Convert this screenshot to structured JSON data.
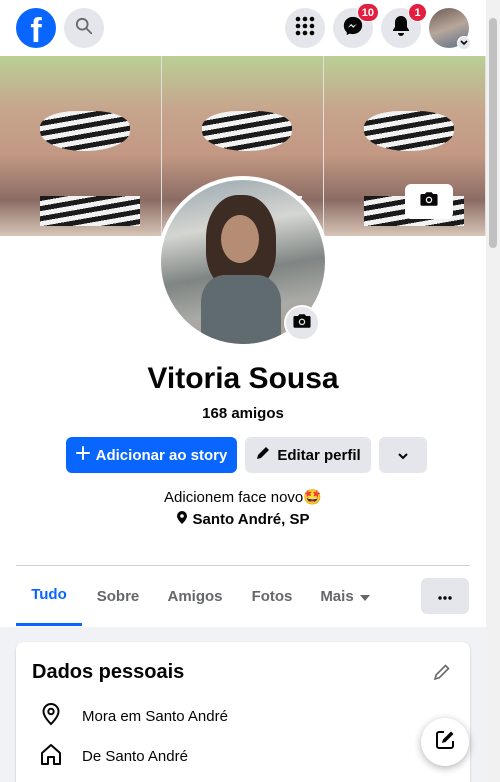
{
  "nav": {
    "logo": "f",
    "messenger_badge": "10",
    "notifications_badge": "1",
    "icons": [
      "search-icon",
      "grid-menu-icon",
      "messenger-icon",
      "bell-icon",
      "chevron-down-icon"
    ]
  },
  "profile": {
    "name": "Vitoria Sousa",
    "friends": "168 amigos",
    "bio": "Adicionem face novo🤩",
    "location": "Santo André, SP"
  },
  "actions": {
    "add_story": "Adicionar ao story",
    "edit_profile": "Editar perfil"
  },
  "tabs": [
    {
      "label": "Tudo",
      "active": true
    },
    {
      "label": "Sobre"
    },
    {
      "label": "Amigos"
    },
    {
      "label": "Fotos"
    },
    {
      "label": "Mais"
    }
  ],
  "personal": {
    "title": "Dados pessoais",
    "rows": [
      "Mora em Santo André",
      "De Santo André"
    ]
  },
  "colors": {
    "brand": "#0866ff",
    "badge": "#e41e3f",
    "button_gray": "#e4e6eb"
  }
}
